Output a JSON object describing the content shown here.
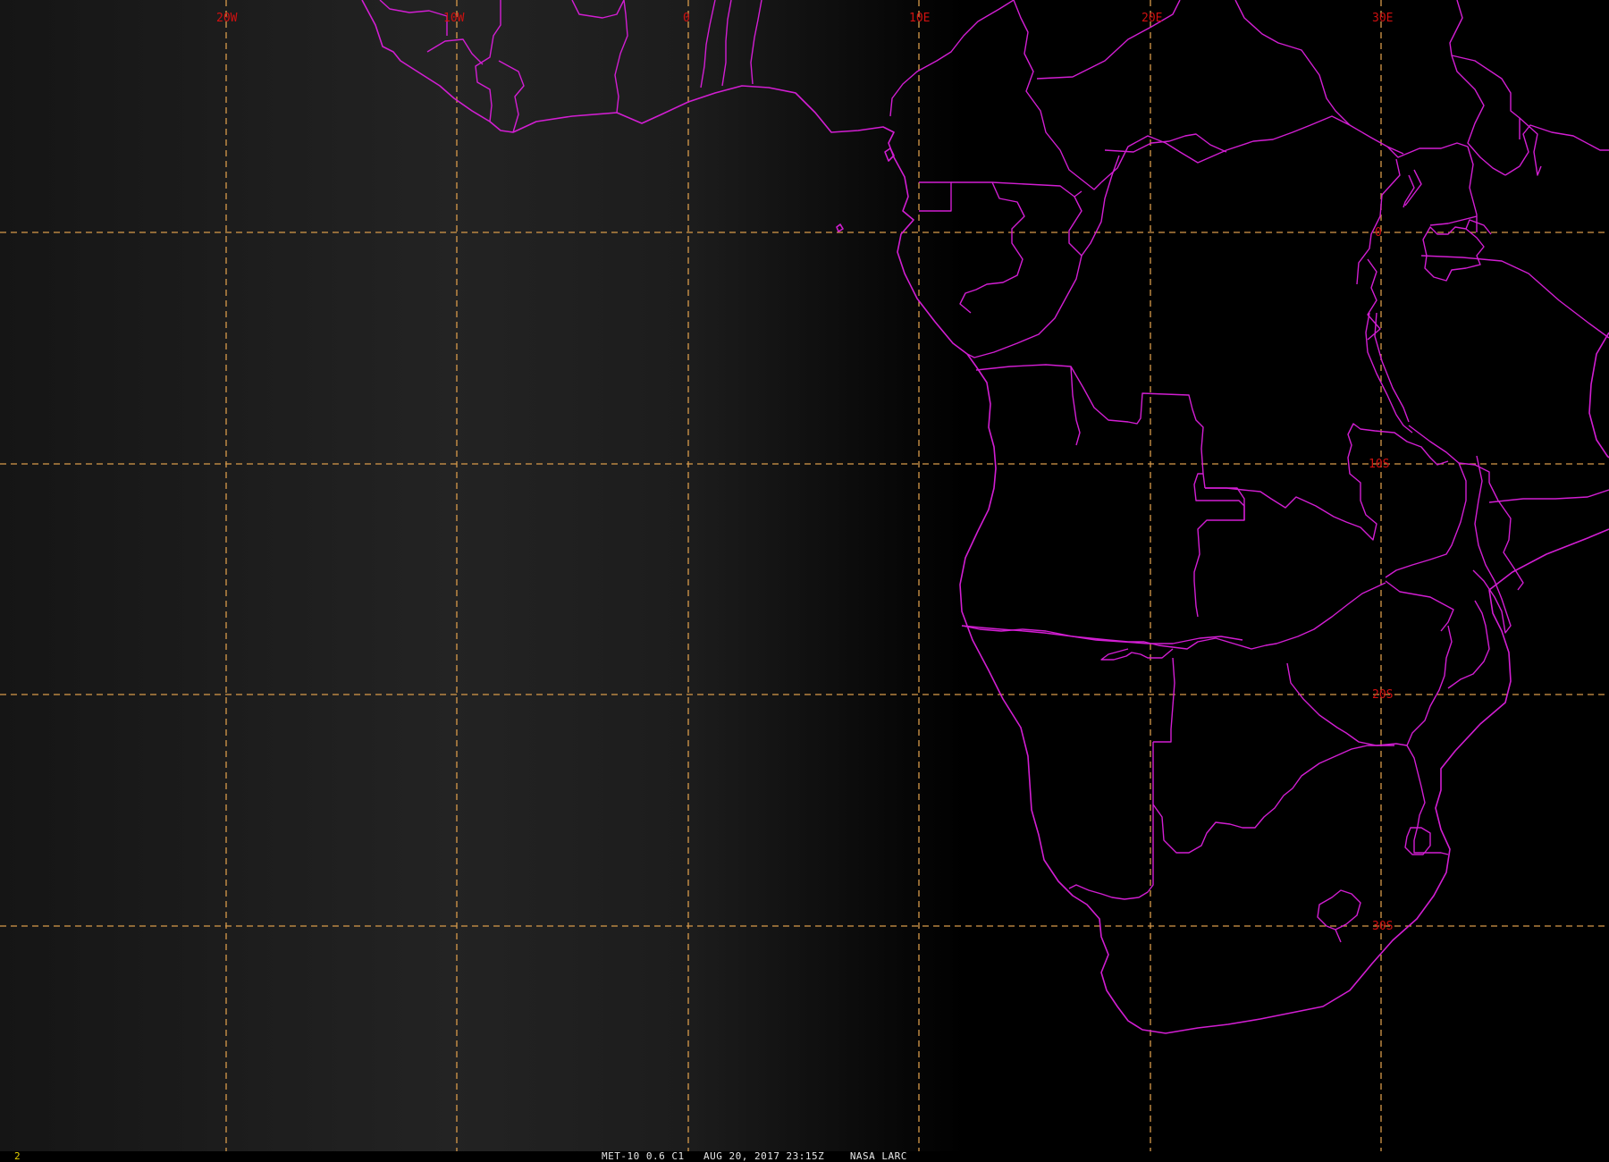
{
  "map": {
    "lon_labels": [
      "20W",
      "10W",
      "0",
      "10E",
      "20E",
      "30E"
    ],
    "lat_labels": [
      "0",
      "10S",
      "20S",
      "30S"
    ],
    "colors": {
      "grid": "#d89a4a",
      "boundaries": "#d21ed2",
      "labels": "#d01010",
      "frame_number": "#e6d200"
    }
  },
  "statusbar": {
    "frame": "2",
    "satellite": "MET-10 0.6 C1",
    "datetime": "AUG 20, 2017 23:15Z",
    "source": "NASA LARC"
  }
}
